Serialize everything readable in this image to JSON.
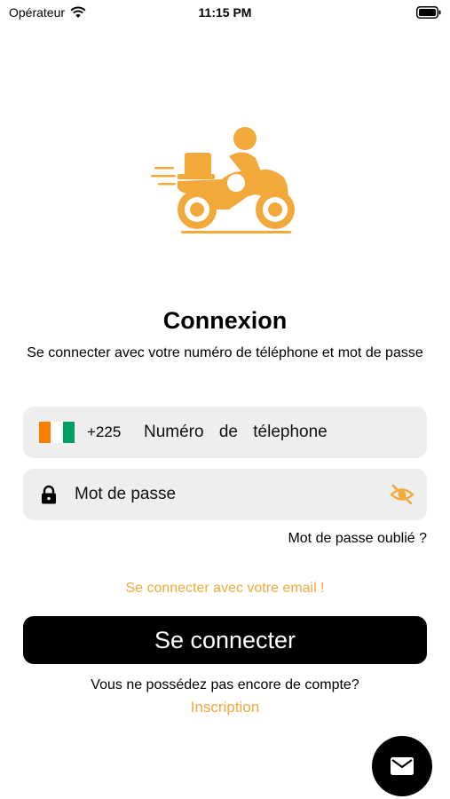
{
  "status_bar": {
    "carrier": "Opérateur",
    "time": "11:15 PM"
  },
  "colors": {
    "accent": "#f2a93b",
    "field_bg": "#eeeeee",
    "button_bg": "#000000",
    "flag_orange": "#f77f00",
    "flag_white": "#ffffff",
    "flag_green": "#009e60"
  },
  "icons": {
    "hero": "delivery-scooter-icon",
    "lock": "lock-icon",
    "visibility": "eye-off-icon",
    "fab": "mail-icon"
  },
  "login": {
    "title": "Connexion",
    "subtitle": "Se connecter avec votre numéro de téléphone et mot de passe",
    "dial_code": "+225",
    "phone_placeholder": "Numéro de télephone",
    "password_placeholder": "Mot de passe",
    "forgot_label": "Mot de passe oublié ?",
    "email_login_label": "Se connecter avec votre email !",
    "submit_label": "Se connecter",
    "no_account_label": "Vous ne possédez pas encore de compte?",
    "signup_label": "Inscription"
  }
}
